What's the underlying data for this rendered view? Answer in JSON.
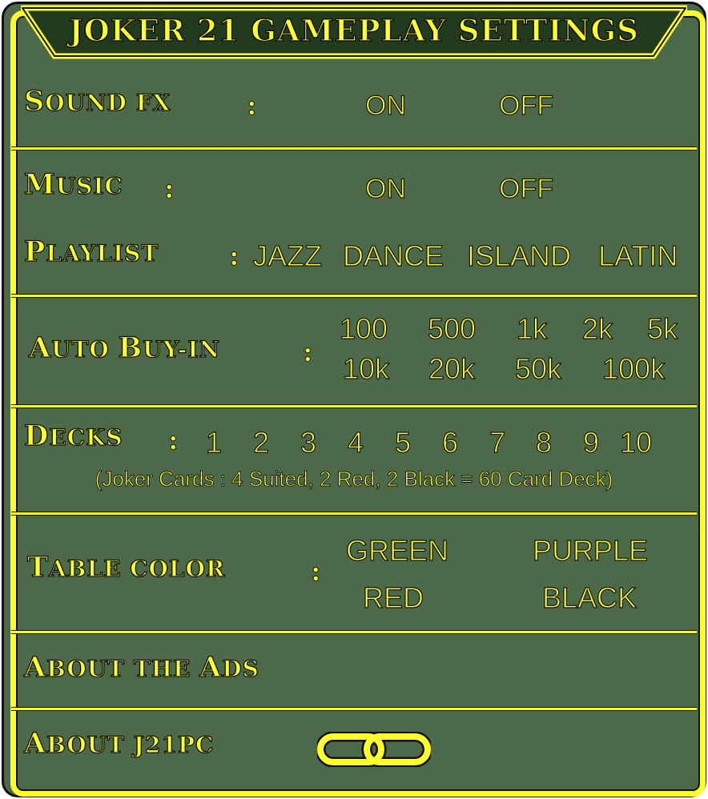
{
  "title": "JOKER 21 GAMEPLAY SETTINGS",
  "sound_fx": {
    "label_cap": "S",
    "label_rest": "OUND FX",
    "colon": ":",
    "on": "ON",
    "off": "OFF"
  },
  "music": {
    "label_cap": "M",
    "label_rest": "USIC",
    "colon": ":",
    "on": "ON",
    "off": "OFF"
  },
  "playlist": {
    "label_cap": "P",
    "label_rest": "LAYLIST",
    "colon": ":",
    "options": [
      "JAZZ",
      "DANCE",
      "ISLAND",
      "LATIN"
    ]
  },
  "auto_buyin": {
    "label_cap1": "A",
    "label_rest1": "UTO ",
    "label_cap2": "B",
    "label_rest2": "UY-IN",
    "colon": ":",
    "row1": [
      "100",
      "500",
      "1k",
      "2k",
      "5k"
    ],
    "row2": [
      "10k",
      "20k",
      "50k",
      "100k"
    ]
  },
  "decks": {
    "label_cap": "D",
    "label_rest": "ECKS",
    "colon": ":",
    "options": [
      "1",
      "2",
      "3",
      "4",
      "5",
      "6",
      "7",
      "8",
      "9",
      "10"
    ],
    "note": "(Joker Cards : 4 Suited, 2 Red, 2 Black = 60 Card Deck)"
  },
  "table_color": {
    "label_cap": "T",
    "label_rest": "ABLE COLOR",
    "colon": ":",
    "options": [
      "GREEN",
      "PURPLE",
      "RED",
      "BLACK"
    ]
  },
  "about_ads": {
    "label_cap1": "A",
    "label_rest1": "BOUT THE ",
    "label_cap2": "A",
    "label_rest2": "DS"
  },
  "about_j21pc": {
    "label_cap": "A",
    "label_rest": "BOUT J21PC"
  },
  "icons": {
    "link": "link-icon"
  },
  "colors": {
    "background": "#4c6a49",
    "accent": "#ffff2a",
    "header": "#223a1e",
    "outline": "#111111"
  }
}
